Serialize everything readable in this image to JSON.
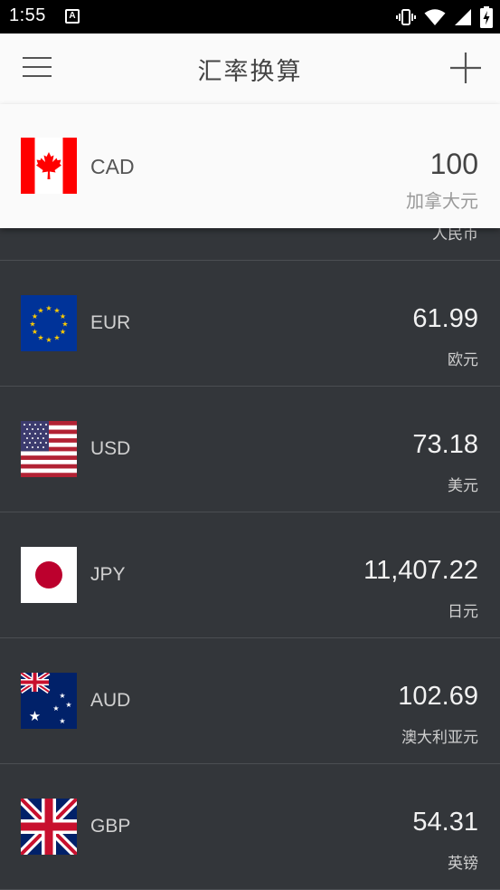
{
  "status_bar": {
    "time": "1:55",
    "notification_letter": "A"
  },
  "app_bar": {
    "title": "汇率换算"
  },
  "base_currency": {
    "code": "CAD",
    "amount": "100",
    "name": "加拿大元"
  },
  "peek_row": {
    "name": "人民币"
  },
  "rates": [
    {
      "code": "EUR",
      "amount": "61.99",
      "name": "欧元",
      "flag": "eu"
    },
    {
      "code": "USD",
      "amount": "73.18",
      "name": "美元",
      "flag": "us"
    },
    {
      "code": "JPY",
      "amount": "11,407.22",
      "name": "日元",
      "flag": "jp"
    },
    {
      "code": "AUD",
      "amount": "102.69",
      "name": "澳大利亚元",
      "flag": "au"
    },
    {
      "code": "GBP",
      "amount": "54.31",
      "name": "英镑",
      "flag": "gb"
    }
  ],
  "colors": {
    "list_background": "#33363a",
    "header_background": "#fafafa",
    "divider": "#4b4e52"
  }
}
